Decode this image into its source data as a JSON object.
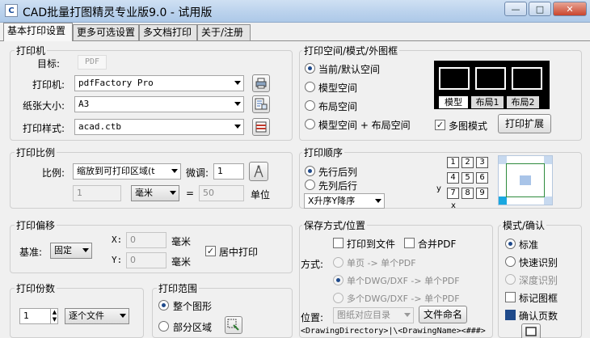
{
  "window": {
    "title": "CAD批量打图精灵专业版9.0 - 试用版",
    "btn_min": "—",
    "btn_max": "□",
    "btn_close": "✕"
  },
  "tabs": [
    "基本打印设置",
    "更多可选设置",
    "多文档打印",
    "关于/注册"
  ],
  "printer": {
    "group_title": "打印机",
    "target_label": "目标:",
    "target_value": "PDF",
    "printer_label": "打印机:",
    "printer_value": "pdfFactory Pro",
    "paper_label": "纸张大小:",
    "paper_value": "A3",
    "style_label": "打印样式:",
    "style_value": "acad.ctb"
  },
  "space": {
    "group_title": "打印空间/模式/外图框",
    "options": [
      "当前/默认空间",
      "模型空间",
      "布局空间",
      "模型空间 + 布局空间"
    ],
    "selected": 0,
    "preview_tabs": [
      "模型",
      "布局1",
      "布局2"
    ],
    "multi_mode_label": "多图模式",
    "multi_mode_checked": true,
    "expand_button": "打印扩展"
  },
  "scale": {
    "group_title": "打印比例",
    "ratio_label": "比例:",
    "ratio_value": "缩放到可打印区域(t",
    "fine_label": "微调:",
    "fine_value": "1",
    "value1": "1",
    "unit_value": "毫米",
    "equals": "=",
    "value2": "50",
    "unit_label": "单位"
  },
  "order": {
    "group_title": "打印顺序",
    "options": [
      "先行后列",
      "先列后行"
    ],
    "selected": 0,
    "sort_value": "X升序Y降序",
    "grid": [
      "1",
      "2",
      "3",
      "4",
      "5",
      "6",
      "7",
      "8",
      "9"
    ],
    "axis_y": "y",
    "axis_x": "x"
  },
  "offset": {
    "group_title": "打印偏移",
    "base_label": "基准:",
    "base_value": "固定",
    "x_label": "X:",
    "x_value": "0",
    "x_unit": "毫米",
    "y_label": "Y:",
    "y_value": "0",
    "y_unit": "毫米",
    "center_label": "居中打印",
    "center_checked": true
  },
  "save": {
    "group_title": "保存方式/位置",
    "print_to_file": "打印到文件",
    "merge_pdf": "合并PDF",
    "mode_label": "方式:",
    "modes": [
      "单页 -> 单个PDF",
      "单个DWG/DXF -> 单个PDF",
      "多个DWG/DXF -> 单个PDF"
    ],
    "location_label": "位置:",
    "location_value": "图纸对应目录",
    "filename_button": "文件命名",
    "path": "<DrawingDirectory>|\\<DrawingName><###>"
  },
  "confirm": {
    "group_title": "模式/确认",
    "options": [
      "标准",
      "快速识别",
      "深度识别"
    ],
    "selected": 0,
    "mark_frame": "标记图框",
    "confirm_pages": "确认页数"
  },
  "copies": {
    "group_title": "打印份数",
    "value": "1",
    "per_value": "逐个文件"
  },
  "range": {
    "group_title": "打印范围",
    "options": [
      "整个图形",
      "部分区域"
    ],
    "selected": 0
  },
  "colors": {
    "accent": "#1f4a8b",
    "selection": "#cfe0f3"
  }
}
